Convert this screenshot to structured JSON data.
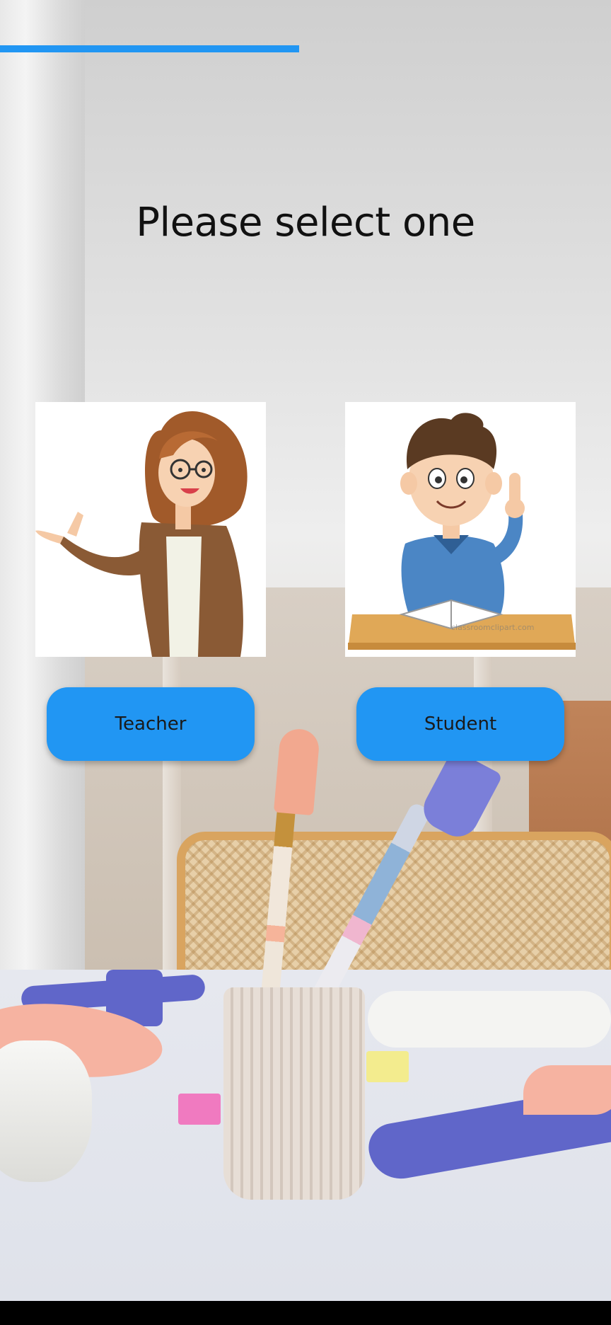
{
  "progress": {
    "value_percent": 49,
    "color": "#2196f3"
  },
  "title": "Please select one",
  "options": [
    {
      "id": "teacher",
      "label": "Teacher",
      "image": "teacher-illustration"
    },
    {
      "id": "student",
      "label": "Student",
      "image": "student-illustration"
    }
  ],
  "student_image_watermark": "classroomclipart.com",
  "colors": {
    "button": "#2196f3",
    "button_text": "#1a1a1a",
    "title_text": "#111111",
    "nav_bar": "#000000"
  },
  "background": "art-supplies-photo"
}
